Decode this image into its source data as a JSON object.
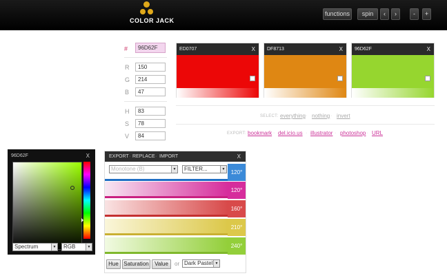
{
  "app": {
    "logo_text": "COLOR JACK"
  },
  "header": {
    "buttons": [
      "functions",
      "spin",
      "‹",
      "›",
      "-",
      "+"
    ]
  },
  "values": {
    "hash": "#",
    "hex": "96D62F",
    "rgb": [
      {
        "label": "R",
        "value": "150"
      },
      {
        "label": "G",
        "value": "214"
      },
      {
        "label": "B",
        "value": "47"
      }
    ],
    "hsv": [
      {
        "label": "H",
        "value": "83"
      },
      {
        "label": "S",
        "value": "78"
      },
      {
        "label": "V",
        "value": "84"
      }
    ]
  },
  "swatches": [
    {
      "code": "ED0707",
      "color": "#ec0707",
      "close": "X"
    },
    {
      "code": "DF8713",
      "color": "#df8713",
      "close": "X"
    },
    {
      "code": "96D62F",
      "color": "#96d62f",
      "close": "X"
    }
  ],
  "select_row": {
    "label": "SELECT:",
    "links": [
      "everything",
      "nothing",
      "invert"
    ]
  },
  "export_row": {
    "label": "EXPORT:",
    "links": [
      "bookmark",
      "del.icio.us",
      "illustrator",
      "photoshop",
      "URL"
    ]
  },
  "picker": {
    "hex": "96D62F",
    "close": "X",
    "mode": "Spectrum",
    "model": "RGB",
    "hue_color": "#9bff00",
    "current_color": "#96d62f"
  },
  "gradient_panel": {
    "tabs": [
      "EXPORT",
      "REPLACE",
      "IMPORT"
    ],
    "close": "X",
    "preset_select": "Monotone (B)",
    "filter_select": "FILTER...",
    "rows": [
      {
        "degree": "120°",
        "from": "#ffffff",
        "to": "#ffffff",
        "under": "#1f6fc4",
        "tab": "#3b8ad8"
      },
      {
        "degree": "120°",
        "from": "#f7e6f2",
        "to": "#d62d9c",
        "under": "#c91f80",
        "tab": "#d62d9c"
      },
      {
        "degree": "160°",
        "from": "#f9e3e3",
        "to": "#d84a4a",
        "under": "#c43030",
        "tab": "#d84a4a"
      },
      {
        "degree": "210°",
        "from": "#faf6da",
        "to": "#dcc84a",
        "under": "#c9b032",
        "tab": "#dcc84a"
      },
      {
        "degree": "240°",
        "from": "#f1fae2",
        "to": "#93cf3a",
        "under": "#7fb82c",
        "tab": "#93cf3a"
      }
    ],
    "buttons": [
      "Hue",
      "Saturation",
      "Value"
    ],
    "or_label": "or",
    "sort_select": "Dark Pastel"
  },
  "colors": {
    "link": "#cc3399"
  }
}
